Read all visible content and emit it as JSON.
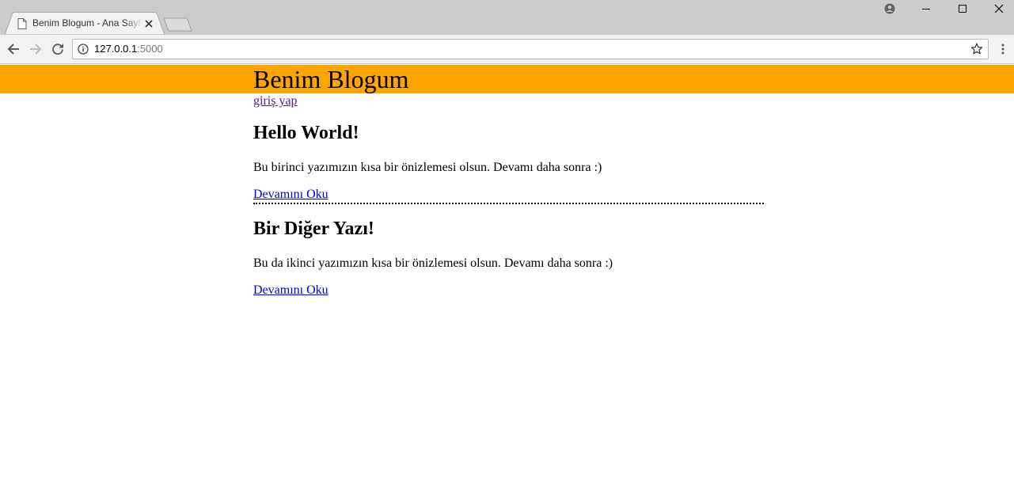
{
  "browser": {
    "tab_title": "Benim Blogum - Ana Sayfa",
    "url_host": "127.0.0.1",
    "url_port": ":5000"
  },
  "site": {
    "title": "Benim Blogum",
    "login_link": "giriş yap",
    "header_color": "#ffa500"
  },
  "posts": [
    {
      "title": "Hello World!",
      "excerpt": "Bu birinci yazımızın kısa bir önizlemesi olsun. Devamı daha sonra :)",
      "read_more": "Devamını Oku"
    },
    {
      "title": "Bir Diğer Yazı!",
      "excerpt": "Bu da ikinci yazımızın kısa bir önizlemesi olsun. Devamı daha sonra :)",
      "read_more": "Devamını Oku"
    }
  ]
}
